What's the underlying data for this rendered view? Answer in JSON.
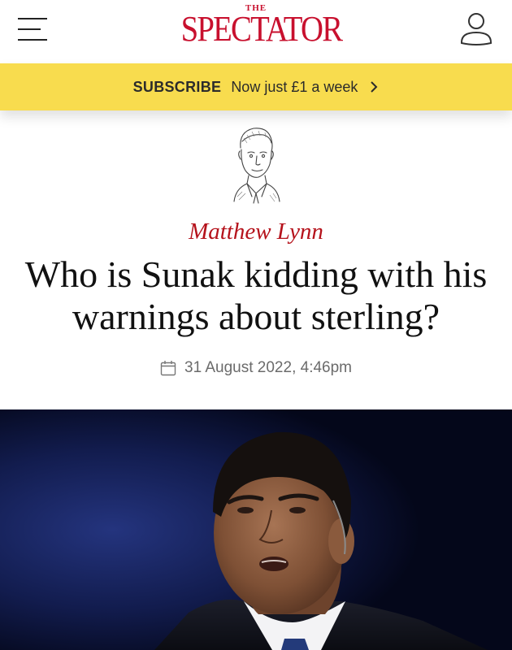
{
  "header": {
    "logo_top": "THE",
    "logo_name": "SPECTATOR",
    "menu_icon": "hamburger-menu-icon",
    "account_icon": "user-account-icon"
  },
  "subscribe": {
    "label": "SUBSCRIBE",
    "offer": "Now just £1 a week",
    "chevron_icon": "chevron-right-icon",
    "background_color": "#f8dc4e"
  },
  "article": {
    "author": "Matthew Lynn",
    "headline": "Who is Sunak kidding with his warnings about sterling?",
    "date": "31 August 2022, 4:46pm",
    "date_icon": "calendar-icon"
  },
  "colors": {
    "brand_red": "#c8102e",
    "author_red": "#b5121b",
    "headline": "#111111",
    "meta_gray": "#6b6b6b"
  }
}
